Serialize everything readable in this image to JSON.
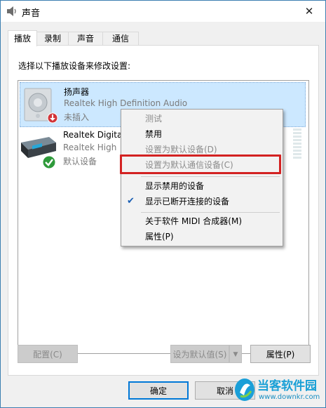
{
  "window": {
    "title": "声音",
    "close_glyph": "✕"
  },
  "tabs": [
    {
      "label": "播放",
      "active": true
    },
    {
      "label": "录制",
      "active": false
    },
    {
      "label": "声音",
      "active": false
    },
    {
      "label": "通信",
      "active": false
    }
  ],
  "panel": {
    "instruction": "选择以下播放设备来修改设置:"
  },
  "devices": [
    {
      "name": "扬声器",
      "description": "Realtek High Definition Audio",
      "status": "未插入",
      "selected": true,
      "icon": "speaker-icon",
      "badge": "unplugged-badge-icon"
    },
    {
      "name": "Realtek Digital",
      "description": "Realtek High",
      "status": "默认设备",
      "selected": false,
      "icon": "digital-output-icon",
      "badge": "default-check-badge-icon"
    }
  ],
  "context_menu": {
    "items": [
      {
        "label": "测试",
        "disabled": true,
        "checked": false
      },
      {
        "label": "禁用",
        "disabled": false,
        "checked": false
      },
      {
        "label": "设置为默认设备(D)",
        "disabled": true,
        "checked": false
      },
      {
        "label": "设置为默认通信设备(C)",
        "disabled": true,
        "checked": false,
        "highlighted_box": true
      },
      {
        "label": "显示禁用的设备",
        "disabled": false,
        "checked": false
      },
      {
        "label": "显示已断开连接的设备",
        "disabled": false,
        "checked": true
      },
      {
        "label": "关于软件 MIDI 合成器(M)",
        "disabled": false,
        "checked": false
      },
      {
        "label": "属性(P)",
        "disabled": false,
        "checked": false
      }
    ]
  },
  "buttons": {
    "configure": "配置(C)",
    "set_default": "设为默认值(S)",
    "properties": "属性(P)",
    "ok": "确定",
    "cancel": "取消"
  },
  "watermark": {
    "title": "当客软件园",
    "url": "www.downkr.com"
  },
  "colors": {
    "accent": "#0078d7",
    "selection": "#cce8ff",
    "highlight_box": "#d32222"
  }
}
